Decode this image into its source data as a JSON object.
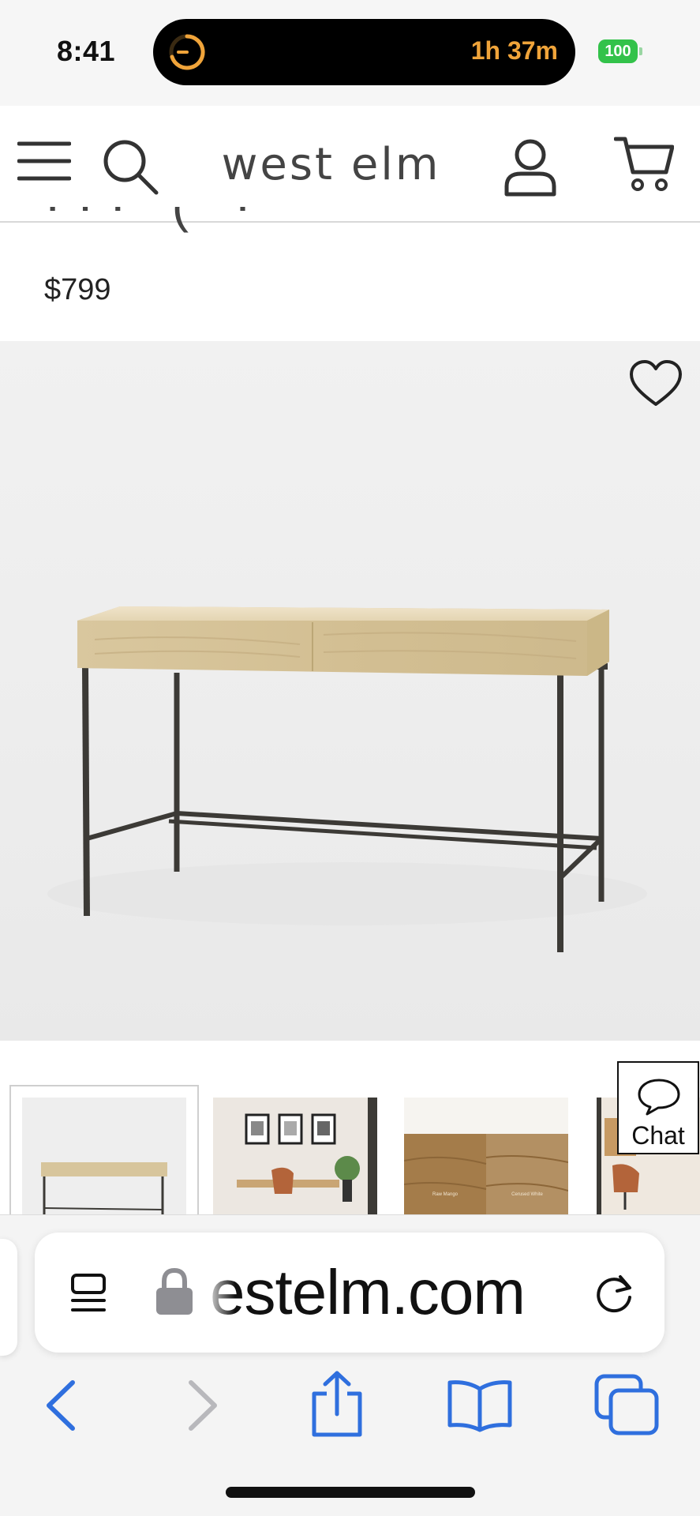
{
  "status_bar": {
    "time": "8:41",
    "live_activity_time": "1h 37m",
    "battery_level": "100",
    "accent_color": "#f0a43a",
    "battery_color": "#33c24a"
  },
  "site_header": {
    "logo": "west elm",
    "icons": [
      "menu-icon",
      "search-icon",
      "account-icon",
      "cart-icon"
    ]
  },
  "product": {
    "price": "$799",
    "wishlist_icon": "heart-icon"
  },
  "thumbnails": [
    {
      "label": "desk-front-view",
      "selected": true
    },
    {
      "label": "desk-in-office-scene",
      "selected": false
    },
    {
      "label": "wood-finish-swatches",
      "selected": false,
      "swatch_labels": [
        "Raw Mango",
        "Cerused White"
      ]
    },
    {
      "label": "desk-with-chair-scene",
      "selected": false
    }
  ],
  "chat": {
    "label": "Chat"
  },
  "browser": {
    "url_display": "estelm.com",
    "toolbar": [
      "back-button",
      "forward-button",
      "share-button",
      "bookmarks-button",
      "tabs-button"
    ],
    "accent_color": "#2f6fde"
  }
}
